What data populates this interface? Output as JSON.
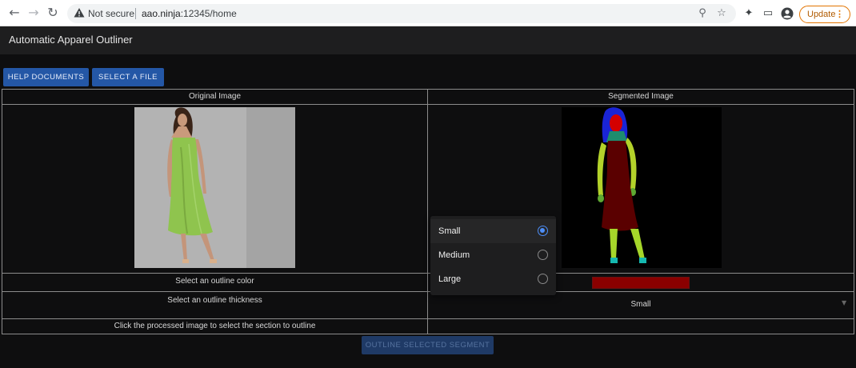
{
  "browser": {
    "security_label": "Not secure",
    "url_host": "aao.ninja",
    "url_rest": ":12345/home",
    "update_label": "Update"
  },
  "app": {
    "title": "Automatic Apparel Outliner"
  },
  "toolbar": {
    "help_label": "HELP DOCUMENTS",
    "select_file_label": "SELECT A FILE"
  },
  "table": {
    "original_header": "Original Image",
    "segmented_header": "Segmented Image",
    "color_label": "Select an outline color",
    "thickness_label": "Select an outline thickness",
    "click_label": "Click the processed image to select the section to outline",
    "outline_color": "#8a0000",
    "thickness_value": "Small"
  },
  "thickness_menu": {
    "options": [
      "Small",
      "Medium",
      "Large"
    ],
    "selected": "Small"
  },
  "actions": {
    "outline_label": "OUTLINE SELECTED SEGMENT"
  },
  "colors": {
    "accent": "#2457a6",
    "radio_selected": "#4d8ef7",
    "dress_green": "#8fc44e",
    "segment_dress": "#5a0000",
    "segment_skin": "#b3d22a",
    "segment_hair": "#1a24d6",
    "segment_face": "#d40000"
  }
}
